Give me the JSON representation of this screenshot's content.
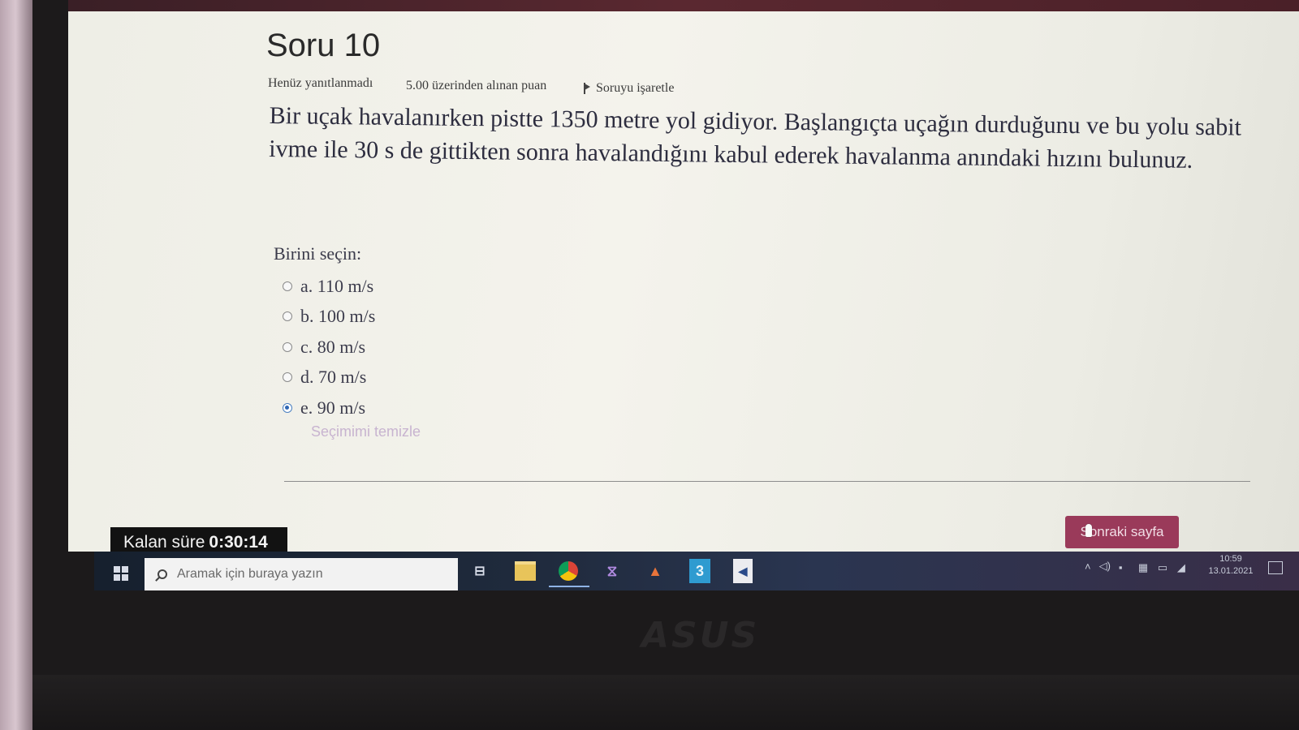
{
  "question": {
    "title": "Soru 10",
    "status": "Henüz yanıtlanmadı",
    "points": "5.00 üzerinden alınan puan",
    "flag_label": "Soruyu işaretle",
    "text": "Bir uçak havalanırken pistte 1350 metre yol gidiyor. Başlangıçta uçağın durduğunu ve bu yolu sabit ivme ile 30 s de gittikten sonra havalandığını kabul ederek havalanma anındaki hızını bulunuz.",
    "prompt": "Birini seçin:",
    "options": [
      {
        "label": "a. 110 m/s",
        "selected": false
      },
      {
        "label": "b. 100 m/s",
        "selected": false
      },
      {
        "label": "c. 80 m/s",
        "selected": false
      },
      {
        "label": "d. 70 m/s",
        "selected": false
      },
      {
        "label": "e. 90 m/s",
        "selected": true
      }
    ],
    "clear_label": "Seçimimi temizle"
  },
  "navigation": {
    "next_label": "Sonraki sayfa"
  },
  "timer": {
    "label": "Kalan süre",
    "value": "0:30:14"
  },
  "taskbar": {
    "search_placeholder": "Aramak için buraya yazın",
    "apps": [
      "task-view-icon",
      "file-explorer-icon",
      "chrome-icon",
      "visual-studio-icon",
      "matlab-icon",
      "app-3-icon",
      "other-app-icon"
    ],
    "app3_glyph": "3",
    "clock_time": "10:59",
    "clock_date": "13.01.2021"
  },
  "hardware": {
    "brand": "ASUS"
  },
  "colors": {
    "next_button": "#9a3a5a",
    "timer_bg": "#121212",
    "selected_radio": "#2f66b3",
    "clear_link": "#c8b4d0"
  }
}
